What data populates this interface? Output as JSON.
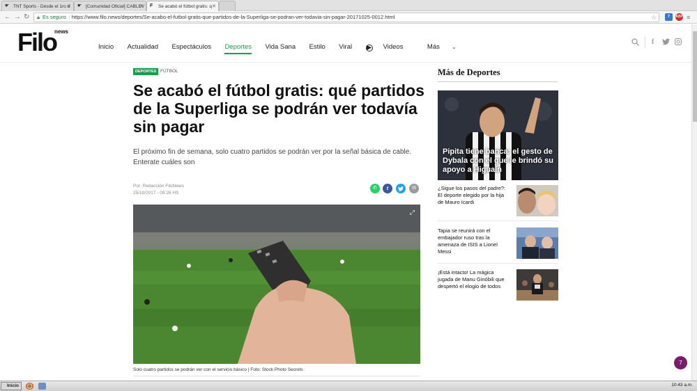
{
  "browser": {
    "tabs": [
      {
        "title": "TNT Sports - Desde el 1ro d",
        "active": false
      },
      {
        "title": "[Comunidad Oficial] CABLEV",
        "active": false
      },
      {
        "title": "Se acabó el fútbol gratis: q",
        "active": true
      }
    ],
    "secure_label": "Es seguro",
    "url": "https://www.filo.news/deportes/Se-acabo-el-futbol-gratis-que-partidos-de-la-Superliga-se-podran-ver-todavia-sin-pagar-20171025-0012.html",
    "extension_badge": "7",
    "abp_label": "ABP"
  },
  "site": {
    "logo": "Filo",
    "logo_sub": "news",
    "nav": [
      "Inicio",
      "Actualidad",
      "Espectáculos",
      "Deportes",
      "Vida Sana",
      "Estilo",
      "Viral",
      "Videos",
      "Más"
    ],
    "active_nav": "Deportes",
    "header_icons": [
      "search-icon",
      "facebook-icon",
      "twitter-icon",
      "instagram-icon"
    ]
  },
  "article": {
    "section_badge": "DEPORTES",
    "sub_section": "FÚTBOL",
    "headline": "Se acabó el fútbol gratis: qué partidos de la Superliga se podrán ver todavía sin pagar",
    "subtitle": "El próximo fin de semana, solo cuatro partidos se podrán ver por la señal básica de cable. Enterate cuáles son",
    "author": "Por: Redacción FiloNews",
    "date": "25/10/2017 - 09:26 HS",
    "share_icons": [
      "whatsapp-icon",
      "facebook-icon",
      "twitter-icon",
      "email-icon"
    ],
    "caption": "Solo cuatro partidos se podrán ver con el servicio básico | Foto: Stock Photo Secrets"
  },
  "sidebar": {
    "title": "Más de Deportes",
    "feature_title": "Pipita tiene banca: el gesto de Dybala con el que le brindó su apoyo a Higuaín",
    "items": [
      {
        "title": "¿Sigue los pasos del padre?: El deporte elegido por la hija de Mauro Icardi"
      },
      {
        "title": "Tapia se reunirá con el embajador ruso tras la amenaza de ISIS a Lionel Messi"
      },
      {
        "title": "¡Está intacto! La mágica jugada de Manu Ginóbili que despertó el elogio de todos"
      }
    ]
  },
  "chat_badge": "7",
  "taskbar": {
    "start": "Inicio",
    "clock": "10:43 a.m."
  },
  "colors": {
    "accent_green": "#12a14b",
    "whatsapp": "#25d366",
    "facebook": "#3b5998",
    "twitter": "#1da1f2",
    "email": "#9a9a9a",
    "chat": "#7a1c6b"
  }
}
